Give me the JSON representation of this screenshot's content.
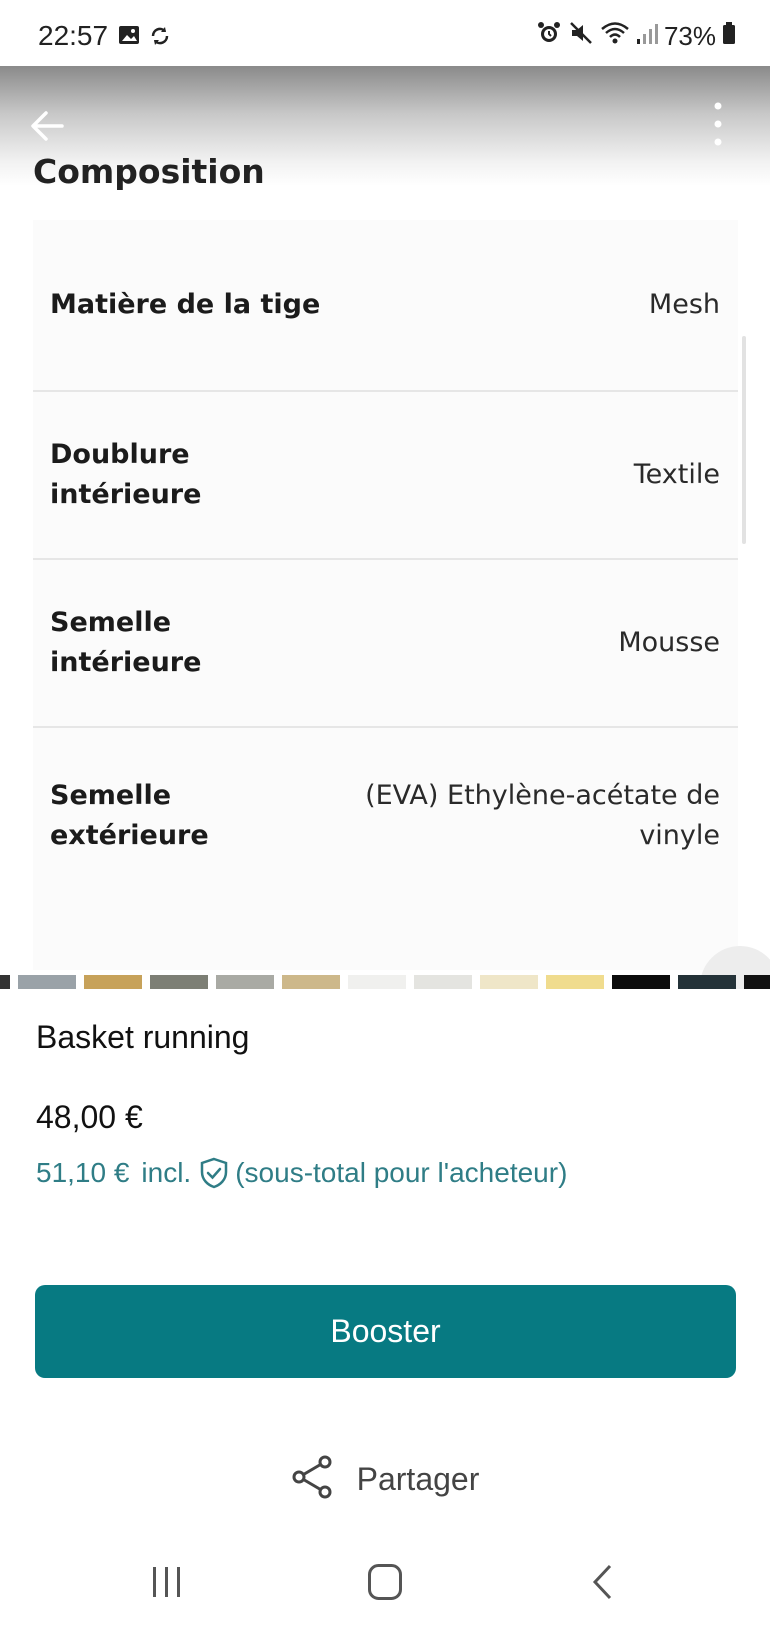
{
  "status_bar": {
    "time": "22:57",
    "battery": "73%",
    "icons": [
      "gallery-icon",
      "sync-icon",
      "alarm-icon",
      "mute-icon",
      "wifi-icon",
      "signal-icon",
      "battery-icon"
    ]
  },
  "header": {
    "back_icon": "arrow-left-icon",
    "more_icon": "more-vertical-icon"
  },
  "composition": {
    "title": "Composition",
    "rows": [
      {
        "label": "Matière de la tige",
        "value": "Mesh"
      },
      {
        "label": "Doublure intérieure",
        "value": "Textile"
      },
      {
        "label": "Semelle intérieure",
        "value": "Mousse"
      },
      {
        "label": "Semelle extérieure",
        "value": "(EVA) Ethylène-acétate de vinyle"
      }
    ]
  },
  "listing": {
    "title": "Basket running",
    "price": "48,00 €",
    "price_incl": "51,10 €",
    "incl_word": "incl.",
    "incl_note": "(sous-total pour l'acheteur)",
    "accent_color": "#2f7d86"
  },
  "actions": {
    "booster_label": "Booster",
    "booster_color": "#077a82",
    "share_label": "Partager"
  },
  "nav": {
    "icons": [
      "recent-apps-icon",
      "home-icon",
      "back-icon"
    ]
  }
}
